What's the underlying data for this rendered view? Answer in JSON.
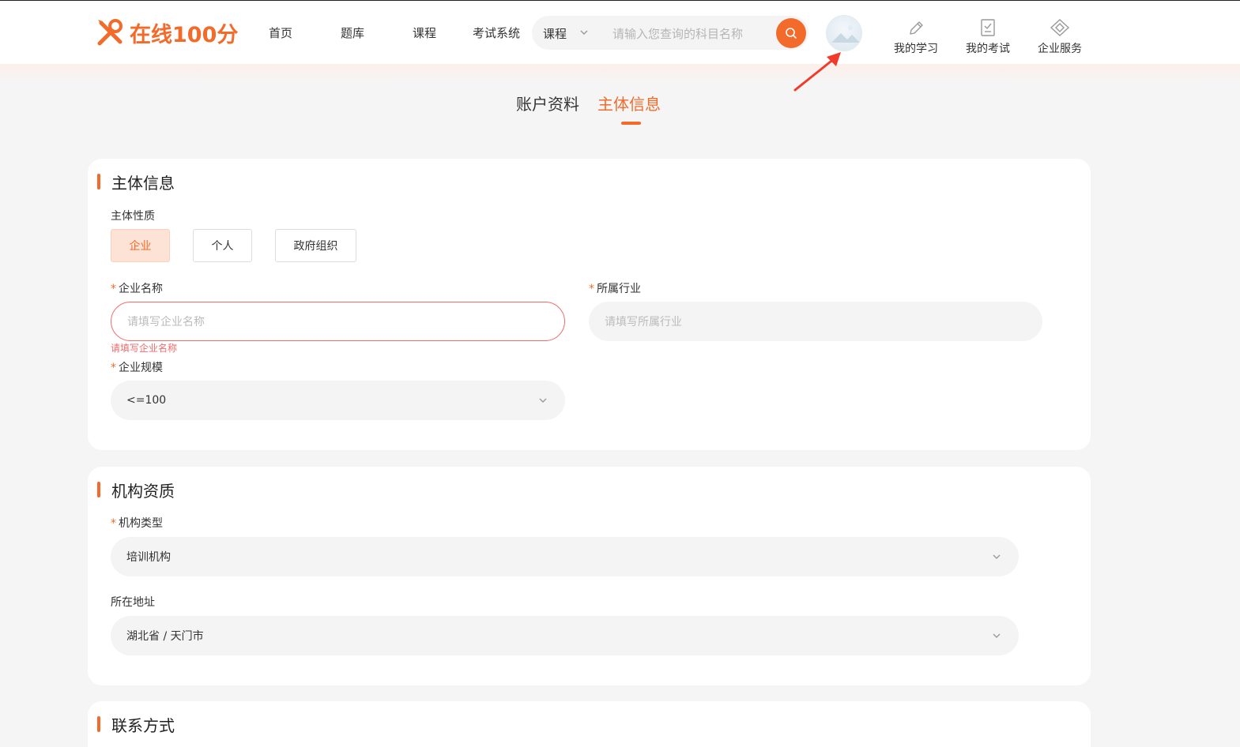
{
  "brand": {
    "name": "在线100分",
    "accent": "#f26b2b"
  },
  "nav": [
    "首页",
    "题库",
    "课程",
    "考试系统"
  ],
  "search": {
    "category": "课程",
    "placeholder": "请输入您查询的科目名称"
  },
  "quick_links": [
    {
      "label": "我的学习",
      "icon": "pencil-icon"
    },
    {
      "label": "我的考试",
      "icon": "exam-clipboard-icon"
    },
    {
      "label": "企业服务",
      "icon": "diamond-service-icon"
    }
  ],
  "tabs": [
    {
      "label": "账户资料",
      "active": false
    },
    {
      "label": "主体信息",
      "active": true
    }
  ],
  "section_subject": {
    "title": "主体信息",
    "nature_label": "主体性质",
    "nature_options": [
      "企业",
      "个人",
      "政府组织"
    ],
    "nature_selected": "企业",
    "company_name_label": "企业名称",
    "company_name_placeholder": "请填写企业名称",
    "company_name_error": "请填写企业名称",
    "industry_label": "所属行业",
    "industry_placeholder": "请填写所属行业",
    "scale_label": "企业规模",
    "scale_value": "<=100"
  },
  "section_qualification": {
    "title": "机构资质",
    "type_label": "机构类型",
    "type_value": "培训机构",
    "address_label": "所在地址",
    "address_value": "湖北省 / 天门市"
  },
  "section_contact": {
    "title": "联系方式"
  }
}
